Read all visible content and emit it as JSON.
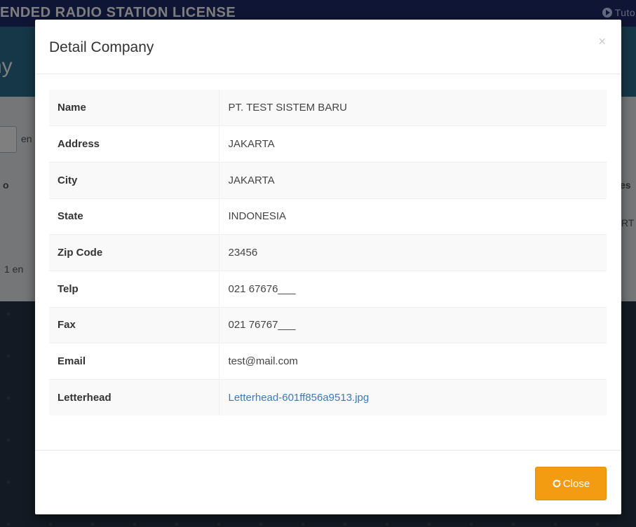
{
  "background": {
    "topbar_title": "IENDED RADIO STATION LICENSE",
    "topbar_link": "Tutori",
    "hero_title": "ny",
    "fragments": {
      "entries_prefix": "en",
      "col_fragment_left": "o",
      "col_fragment_right": "es",
      "cell_fragment_right": "RT",
      "showing_fragment": "1 en"
    }
  },
  "modal": {
    "title": "Detail Company",
    "close_glyph": "×",
    "rows": [
      {
        "label": "Name",
        "value": "PT. TEST SISTEM BARU"
      },
      {
        "label": "Address",
        "value": "JAKARTA"
      },
      {
        "label": "City",
        "value": "JAKARTA"
      },
      {
        "label": "State",
        "value": "INDONESIA"
      },
      {
        "label": "Zip Code",
        "value": "23456"
      },
      {
        "label": "Telp",
        "value": "021 67676___"
      },
      {
        "label": "Fax",
        "value": "021 76767___"
      },
      {
        "label": "Email",
        "value": "test@mail.com"
      },
      {
        "label": "Letterhead",
        "value": "Letterhead-601ff856a9513.jpg"
      }
    ],
    "footer": {
      "close_button_label": "Close",
      "close_button_icon": "refresh-icon",
      "close_button_color": "#f39c12"
    }
  },
  "colors": {
    "topbar": "#1f2a6b",
    "hero": "#2b6f8e",
    "link": "#3a7ab7",
    "accent": "#f39c12"
  }
}
